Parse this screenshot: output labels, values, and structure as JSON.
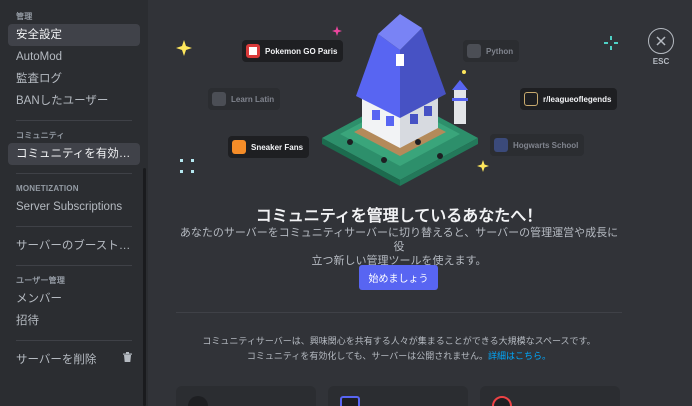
{
  "sidebar": {
    "section_admin": "管理",
    "item_safety": "安全設定",
    "item_automod": "AutoMod",
    "item_audit_log": "監査ログ",
    "item_bans": "BANしたユーザー",
    "section_community": "コミュニティ",
    "item_enable_community": "コミュニティを有効にする",
    "section_monetization": "MONETIZATION",
    "item_server_subscriptions": "Server Subscriptions",
    "item_boost_status": "サーバーのブースト状態",
    "section_user_management": "ユーザー管理",
    "item_members": "メンバー",
    "item_invites": "招待",
    "item_delete_server": "サーバーを削除"
  },
  "close": {
    "label": "ESC"
  },
  "hero": {
    "pills": {
      "pokemon": "Pokemon GO Paris",
      "python": "Python",
      "learn_latin": "Learn Latin",
      "league": "r/leagueoflegends",
      "sneaker": "Sneaker Fans",
      "hogwarts": "Hogwarts School"
    }
  },
  "main": {
    "headline": "コミュニティを管理しているあなたへ！",
    "description_line1": "あなたのサーバーをコミュニティサーバーに切り替えると、サーバーの管理運営や成長に役",
    "description_line2": "立つ新しい管理ツールを使えます。",
    "cta_label": "始めましょう",
    "info_line1": "コミュニティサーバーは、興味関心を共有する人々が集まることができる大規模なスペースです。",
    "info_line2": "コミュニティを有効化しても、サーバーは公開されません。",
    "info_link": "詳細はこちら。"
  },
  "colors": {
    "accent": "#5865f2",
    "link": "#00a8fc",
    "background": "#313338",
    "sidebar": "#2b2d31"
  }
}
